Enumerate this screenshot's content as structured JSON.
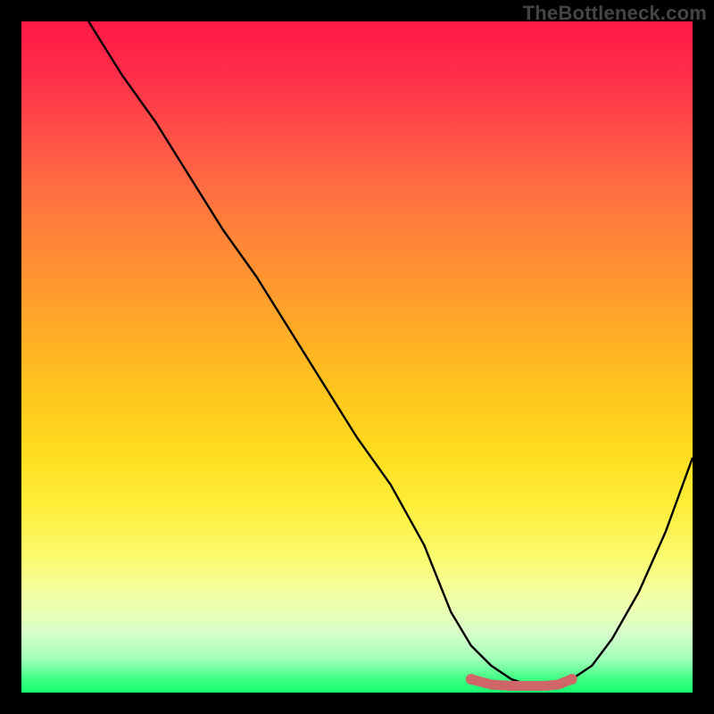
{
  "watermark": "TheBottleneck.com",
  "chart_data": {
    "type": "line",
    "title": "",
    "xlabel": "",
    "ylabel": "",
    "xlim": [
      0,
      100
    ],
    "ylim": [
      0,
      100
    ],
    "grid": false,
    "legend": false,
    "series": [
      {
        "name": "bottleneck-curve",
        "color": "#000000",
        "x": [
          10,
          15,
          20,
          25,
          30,
          35,
          40,
          45,
          50,
          55,
          60,
          62,
          64,
          67,
          70,
          73,
          76,
          78,
          80,
          82,
          85,
          88,
          92,
          96,
          100
        ],
        "y": [
          100,
          92,
          85,
          77,
          69,
          62,
          54,
          46,
          38,
          31,
          22,
          17,
          12,
          7,
          4,
          2,
          1,
          1,
          1,
          2,
          4,
          8,
          15,
          24,
          35
        ]
      },
      {
        "name": "optimal-zone-highlight",
        "color": "#cf6667",
        "x": [
          67,
          70,
          73,
          76,
          78,
          80,
          82
        ],
        "y": [
          2,
          1.2,
          1,
          1,
          1,
          1.2,
          2
        ]
      }
    ],
    "colors": {
      "gradient_top": "#ff1845",
      "gradient_mid": "#fec81d",
      "gradient_bottom": "#16ff70",
      "curve": "#000000",
      "highlight": "#cf6667",
      "frame": "#000000"
    }
  }
}
